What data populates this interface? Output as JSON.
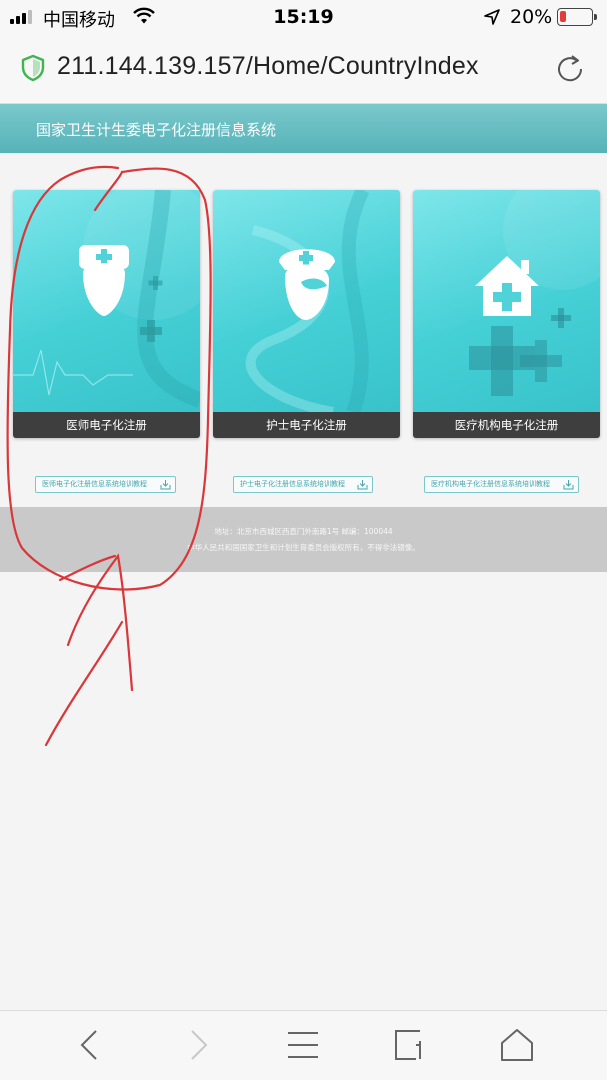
{
  "status_bar": {
    "carrier": "中国移动",
    "time": "15:19",
    "battery_text": "20%",
    "battery_level": 0.2,
    "icons": [
      "signal-icon",
      "wifi-icon",
      "location-arrow-icon",
      "battery-icon"
    ]
  },
  "address_bar": {
    "url": "211.144.139.157/Home/CountryIndex",
    "icons": [
      "shield-icon",
      "reload-icon"
    ]
  },
  "site": {
    "title": "国家卫生计生委电子化注册信息系统"
  },
  "cards": [
    {
      "label": "医师电子化注册",
      "icon": "doctor-icon"
    },
    {
      "label": "护士电子化注册",
      "icon": "nurse-icon"
    },
    {
      "label": "医疗机构电子化注册",
      "icon": "hospital-icon"
    }
  ],
  "tutorials": [
    {
      "label": "医师电子化注册信息系统培训教程"
    },
    {
      "label": "护士电子化注册信息系统培训教程"
    },
    {
      "label": "医疗机构电子化注册信息系统培训教程"
    }
  ],
  "footer": {
    "line1": "地址：北京市西城区西直门外南路1号 邮编：100044",
    "line2": "中华人民共和国国家卫生和计划生育委员会版权所有，不得非法镜像。"
  },
  "toolbar": {
    "buttons": [
      "back-icon",
      "forward-icon",
      "menu-icon",
      "tabs-icon",
      "home-icon"
    ]
  },
  "colors": {
    "header": "#5fb8bd",
    "card": "#4fd3d9",
    "label_bar": "#3e3e3e",
    "footer": "#c9c9c9",
    "annotation": "#d9373a"
  }
}
